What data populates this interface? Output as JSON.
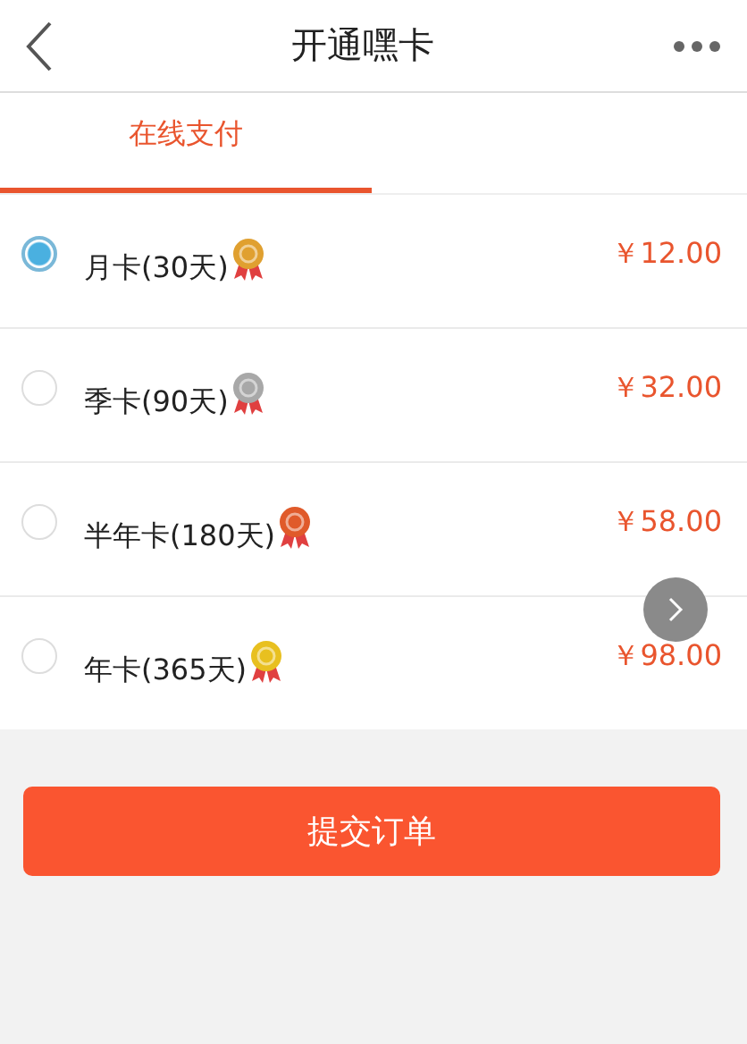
{
  "header": {
    "title": "开通嘿卡"
  },
  "tabs": [
    {
      "label": "在线支付",
      "selected": true
    }
  ],
  "plans": [
    {
      "name": "月卡(30天)",
      "price": "￥12.00",
      "selected": true,
      "color": "#e0a030"
    },
    {
      "name": "季卡(90天)",
      "price": "￥32.00",
      "selected": false,
      "color": "#a8a8a8"
    },
    {
      "name": "半年卡(180天)",
      "price": "￥58.00",
      "selected": false,
      "color": "#e05a2a"
    },
    {
      "name": "年卡(365天)",
      "price": "￥98.00",
      "selected": false,
      "color": "#e8c020"
    }
  ],
  "submit": {
    "label": "提交订单"
  }
}
